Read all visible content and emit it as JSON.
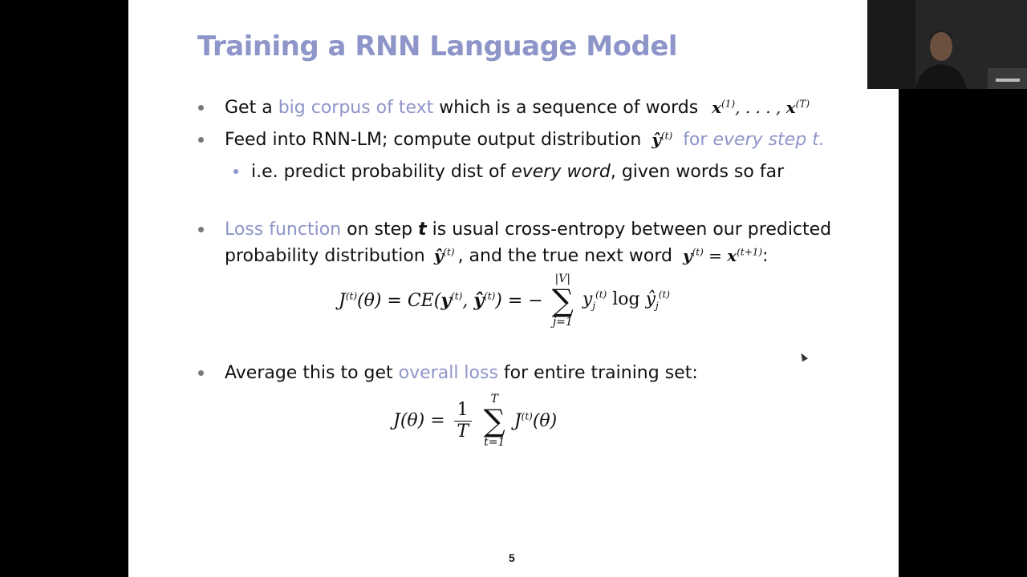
{
  "slide": {
    "title": "Training a RNN Language Model",
    "page_number": "5",
    "bullet1": {
      "pre": "Get a ",
      "hl": "big corpus of text",
      "post": " which is a sequence of words"
    },
    "bullet2": {
      "pre": "Feed into RNN-LM; compute output distribution",
      "hl": "for ",
      "hl_it": "every step t."
    },
    "sub_bullet": {
      "pre": "i.e. predict probability dist of ",
      "it": "every word",
      "post": ", given words so far"
    },
    "bullet3": {
      "hl": "Loss function",
      "line1_post": " on step ",
      "t": "t",
      "line1_end": " is usual cross-entropy between our predicted",
      "line2_pre": "probability distribution",
      "line2_mid": ", and the true next word",
      "line2_end": ":"
    },
    "bullet4": {
      "pre": "Average this to get ",
      "hl": "overall loss",
      "post": " for entire training set:"
    }
  },
  "colors": {
    "accent": "#8e95c8",
    "text": "#111111",
    "background": "#ffffff"
  }
}
